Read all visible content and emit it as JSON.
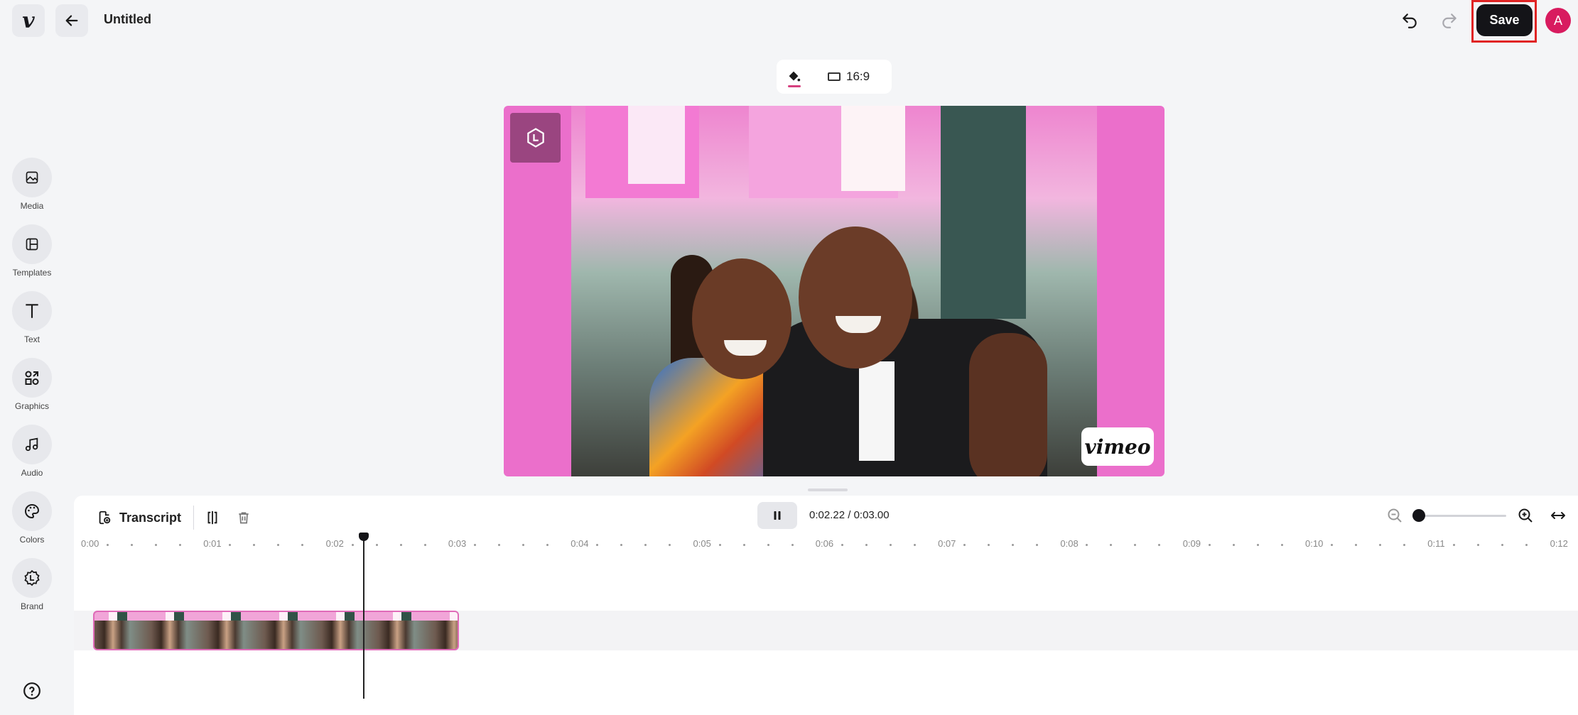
{
  "header": {
    "title": "Untitled",
    "save_label": "Save",
    "avatar_initial": "A",
    "logo_icon": "vimeo-logo-icon",
    "back_icon": "arrow-left-icon",
    "undo_icon": "undo-icon",
    "redo_icon": "redo-icon"
  },
  "canvas_toolbar": {
    "fill_icon": "paint-bucket-icon",
    "aspect_ratio": "16:9"
  },
  "preview": {
    "watermark": "vimeo",
    "brand_icon": "brand-hexagon-icon",
    "background_color": "#eb6fcb"
  },
  "sidebar": {
    "items": [
      {
        "label": "Media",
        "icon": "image-icon"
      },
      {
        "label": "Templates",
        "icon": "layout-icon"
      },
      {
        "label": "Text",
        "icon": "text-icon"
      },
      {
        "label": "Graphics",
        "icon": "shapes-icon"
      },
      {
        "label": "Audio",
        "icon": "music-note-icon"
      },
      {
        "label": "Colors",
        "icon": "palette-icon"
      },
      {
        "label": "Brand",
        "icon": "brand-badge-icon"
      }
    ],
    "help_icon": "help-circle-icon"
  },
  "timeline": {
    "transcript_label": "Transcript",
    "current_time": "0:02.22",
    "separator": " / ",
    "total_time": "0:03.00",
    "ruler_labels": [
      "0:00",
      "0:01",
      "0:02",
      "0:03",
      "0:04",
      "0:05",
      "0:06",
      "0:07",
      "0:08",
      "0:09",
      "0:10",
      "0:11",
      "0:12"
    ],
    "zoom_level": 0.0
  },
  "colors": {
    "accent": "#d81b5f",
    "save_bg": "#141418",
    "highlight": "#e02424"
  }
}
